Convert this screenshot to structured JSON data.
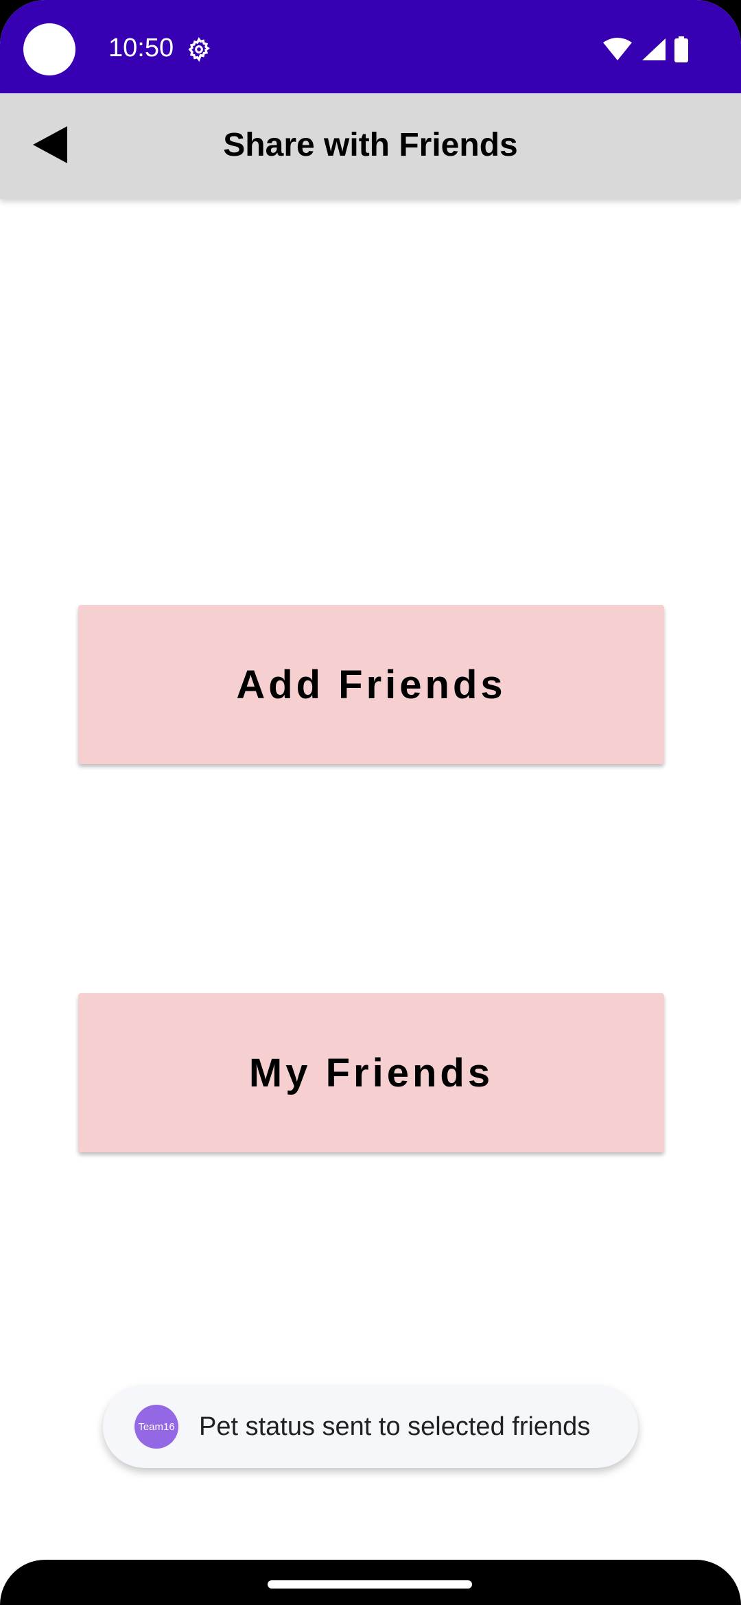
{
  "status_bar": {
    "time": "10:50",
    "background_color": "#3700b3",
    "icons": [
      "settings-gear-icon",
      "wifi-icon",
      "cellular-signal-icon",
      "battery-icon"
    ]
  },
  "app_bar": {
    "title": "Share with Friends",
    "back_icon": "back-arrow-icon",
    "background_color": "#d9d9d9"
  },
  "buttons": {
    "add_friends": "Add Friends",
    "my_friends": "My Friends",
    "background_color": "#f6d0d0"
  },
  "toast": {
    "avatar_label": "Team16",
    "message": "Pet status sent to selected friends",
    "avatar_color": "#9468e4"
  }
}
